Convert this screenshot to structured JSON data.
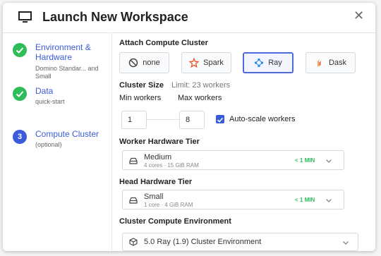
{
  "header": {
    "title": "Launch New Workspace"
  },
  "steps": [
    {
      "label": "Environment & Hardware",
      "desc": "Domino Standar... and Small",
      "status": "done"
    },
    {
      "label": "Data",
      "desc": "quick-start",
      "status": "done"
    },
    {
      "label": "Compute Cluster",
      "desc": "(optional)",
      "number": "3",
      "status": "active"
    }
  ],
  "attach": {
    "title": "Attach Compute Cluster",
    "options": [
      "none",
      "Spark",
      "Ray",
      "Dask"
    ],
    "selected": "Ray"
  },
  "cluster_size": {
    "title": "Cluster Size",
    "limit": "Limit: 23 workers",
    "min_label": "Min workers",
    "max_label": "Max workers",
    "min_value": "1",
    "max_value": "8",
    "autoscale_label": "Auto-scale workers",
    "autoscale_checked": true
  },
  "worker_tier": {
    "title": "Worker Hardware Tier",
    "name": "Medium",
    "spec": "4 cores · 15 GiB RAM",
    "eta": "< 1 MIN"
  },
  "head_tier": {
    "title": "Head Hardware Tier",
    "name": "Small",
    "spec": "1 core · 4 GiB RAM",
    "eta": "< 1 MIN"
  },
  "environment": {
    "title": "Cluster Compute Environment",
    "value": "5.0 Ray (1.9) Cluster Environment"
  },
  "colors": {
    "accent": "#3b5bdb",
    "success": "#2ebd59"
  }
}
